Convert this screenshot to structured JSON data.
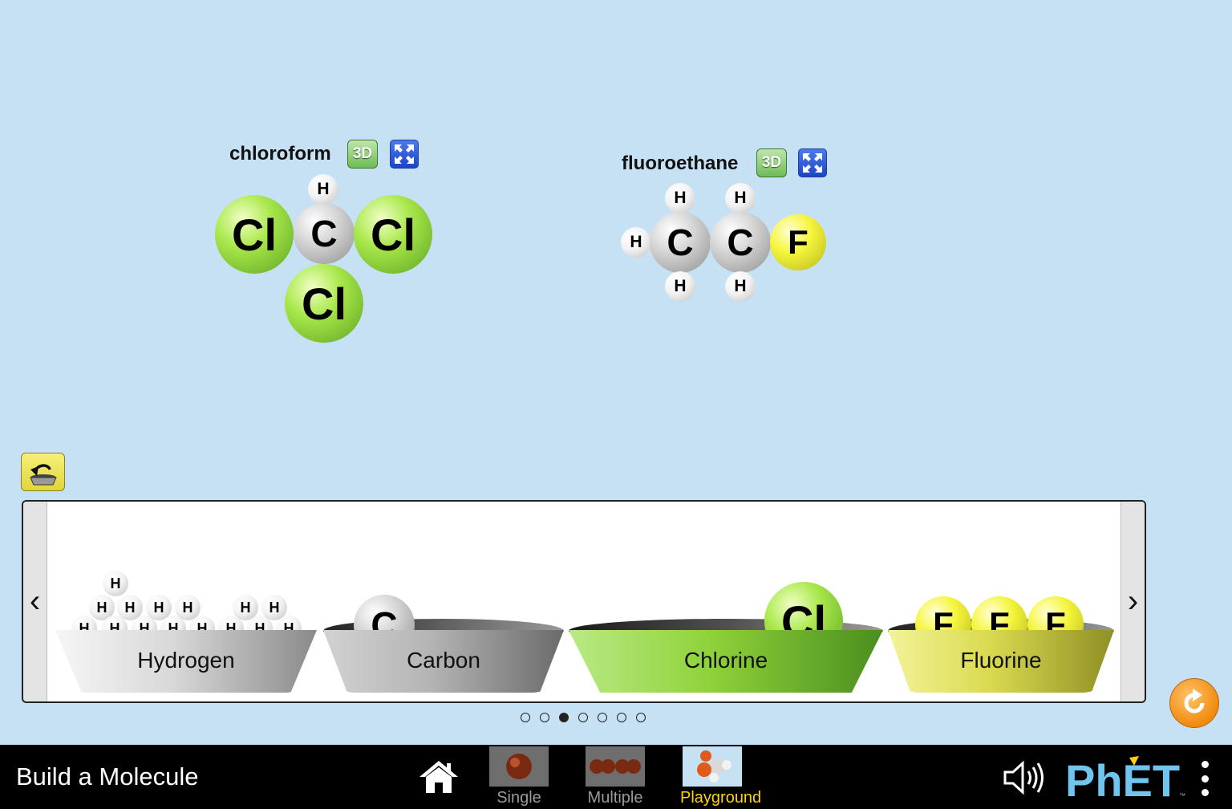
{
  "app": {
    "title": "Build a Molecule"
  },
  "molecules": [
    {
      "name": "chloroform",
      "btn_3d": "3D",
      "atoms": [
        {
          "symbol": "H"
        },
        {
          "symbol": "Cl"
        },
        {
          "symbol": "C"
        },
        {
          "symbol": "Cl"
        },
        {
          "symbol": "Cl"
        }
      ]
    },
    {
      "name": "fluoroethane",
      "btn_3d": "3D",
      "atoms": [
        {
          "symbol": "H"
        },
        {
          "symbol": "H"
        },
        {
          "symbol": "H"
        },
        {
          "symbol": "C"
        },
        {
          "symbol": "C"
        },
        {
          "symbol": "F"
        },
        {
          "symbol": "H"
        },
        {
          "symbol": "H"
        }
      ]
    }
  ],
  "kit": {
    "prev_arrow": "‹",
    "next_arrow": "›",
    "buckets": [
      {
        "label": "Hydrogen",
        "atom_symbol": "H"
      },
      {
        "label": "Carbon",
        "atom_symbol": "C"
      },
      {
        "label": "Chlorine",
        "atom_symbol": "Cl"
      },
      {
        "label": "Fluorine",
        "atom_symbol": "F"
      }
    ],
    "pages": 7,
    "current_page": 3
  },
  "nav": {
    "screens": [
      {
        "label": "Single",
        "selected": false
      },
      {
        "label": "Multiple",
        "selected": false
      },
      {
        "label": "Playground",
        "selected": true
      }
    ],
    "brand": "PhET"
  },
  "colors": {
    "background": "#c6e1f4",
    "navbar": "#000000",
    "selected_screen": "#ffd200",
    "chlorine": "#8fd23a",
    "fluorine": "#f2f23a",
    "carbon": "#b5b5b5",
    "reset": "#f28a0e"
  }
}
